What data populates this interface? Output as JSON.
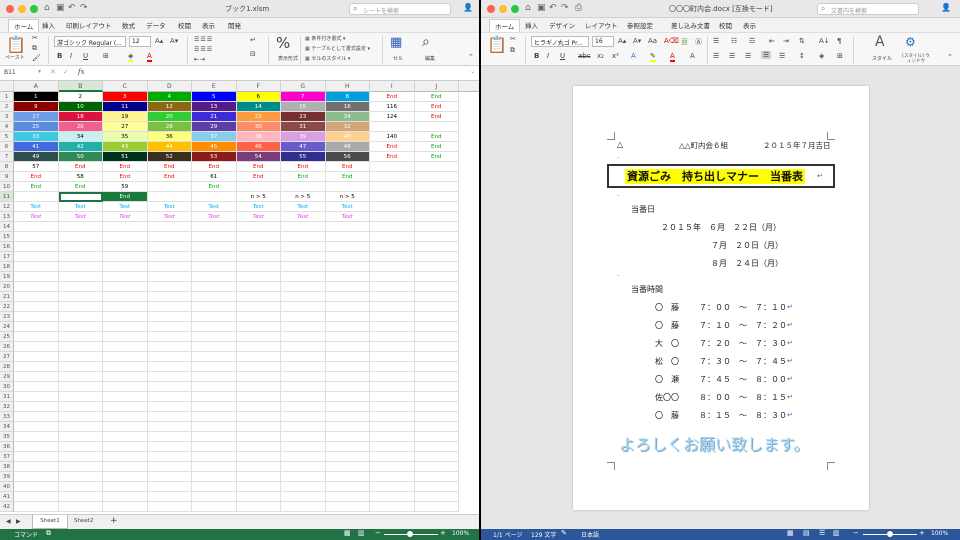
{
  "excel": {
    "title": "ブック1.xlsm",
    "search_placeholder": "シートを検索",
    "tabs": [
      "ホーム",
      "挿入",
      "印刷レイアウト",
      "数式",
      "データ",
      "校閲",
      "表示",
      "開発"
    ],
    "active_tab": "ホーム",
    "font_name": "游ゴシック Regular (...",
    "font_size": "12",
    "paste_label": "ペースト",
    "number_format_label": "表示形式",
    "cond_format_label": "条件付き書式",
    "table_format_label": "テーブルとして書式設定",
    "cell_style_label": "セルのスタイル",
    "cells_label": "セル",
    "edit_label": "編集",
    "name_box": "B11",
    "fx": "fx",
    "columns": [
      "A",
      "B",
      "C",
      "D",
      "E",
      "F",
      "G",
      "H",
      "I",
      "J"
    ],
    "rows": [
      [
        {
          "t": "1",
          "bg": "#000000",
          "fg": "#ffffff"
        },
        {
          "t": "2",
          "bg": "#ffffff",
          "fg": "#000000"
        },
        {
          "t": "3",
          "bg": "#ff0000",
          "fg": "#ffffff"
        },
        {
          "t": "4",
          "bg": "#00aa00",
          "fg": "#ffffff"
        },
        {
          "t": "5",
          "bg": "#0000ff",
          "fg": "#ffffff"
        },
        {
          "t": "6",
          "bg": "#ffff00",
          "fg": "#000000"
        },
        {
          "t": "7",
          "bg": "#ff00cc",
          "fg": "#ffffff"
        },
        {
          "t": "8",
          "bg": "#00a0e0",
          "fg": "#ffffff"
        },
        {
          "t": "End",
          "bg": "",
          "fg": "#ff0000"
        },
        {
          "t": "End",
          "bg": "",
          "fg": "#00aa00"
        }
      ],
      [
        {
          "t": "9",
          "bg": "#8b0000",
          "fg": "#ffffff"
        },
        {
          "t": "10",
          "bg": "#006400",
          "fg": "#ffffff"
        },
        {
          "t": "11",
          "bg": "#00008b",
          "fg": "#ffffff"
        },
        {
          "t": "12",
          "bg": "#8b6914",
          "fg": "#ffffff"
        },
        {
          "t": "13",
          "bg": "#551a8b",
          "fg": "#ffffff"
        },
        {
          "t": "14",
          "bg": "#008b8b",
          "fg": "#ffffff"
        },
        {
          "t": "15",
          "bg": "#b0b0b0",
          "fg": "#ffffff"
        },
        {
          "t": "16",
          "bg": "#707070",
          "fg": "#ffffff"
        },
        {
          "t": "116",
          "bg": "",
          "fg": "#000000"
        },
        {
          "t": "End",
          "bg": "",
          "fg": "#ff0000"
        }
      ],
      [
        {
          "t": "17",
          "bg": "#6a9ee8",
          "fg": "#ffffff"
        },
        {
          "t": "18",
          "bg": "#dc143c",
          "fg": "#ffffff"
        },
        {
          "t": "19",
          "bg": "#fff68f",
          "fg": "#000000"
        },
        {
          "t": "20",
          "bg": "#32cd32",
          "fg": "#ffffff"
        },
        {
          "t": "21",
          "bg": "#3d2bd8",
          "fg": "#ffffff"
        },
        {
          "t": "22",
          "bg": "#ff9a3c",
          "fg": "#ffffff"
        },
        {
          "t": "23",
          "bg": "#7a2f2f",
          "fg": "#ffffff"
        },
        {
          "t": "24",
          "bg": "#8fbc8f",
          "fg": "#ffffff"
        },
        {
          "t": "124",
          "bg": "",
          "fg": "#000000"
        },
        {
          "t": "End",
          "bg": "",
          "fg": "#ff0000"
        }
      ],
      [
        {
          "t": "25",
          "bg": "#5a8de0",
          "fg": "#ffffff"
        },
        {
          "t": "26",
          "bg": "#f06090",
          "fg": "#ffffff"
        },
        {
          "t": "27",
          "bg": "#ffff99",
          "fg": "#000000"
        },
        {
          "t": "28",
          "bg": "#7bc043",
          "fg": "#ffffff"
        },
        {
          "t": "29",
          "bg": "#5b3ea8",
          "fg": "#ffffff"
        },
        {
          "t": "30",
          "bg": "#ff8c69",
          "fg": "#ffffff"
        },
        {
          "t": "31",
          "bg": "#8b4a4a",
          "fg": "#ffffff"
        },
        {
          "t": "32",
          "bg": "#d2a679",
          "fg": "#ffffff"
        },
        {
          "t": "",
          "bg": "",
          "fg": "#000000"
        },
        {
          "t": "",
          "bg": "",
          "fg": "#000000"
        }
      ],
      [
        {
          "t": "33",
          "bg": "#40c8e0",
          "fg": "#ffffff"
        },
        {
          "t": "34",
          "bg": "#c8f0f0",
          "fg": "#000000"
        },
        {
          "t": "35",
          "bg": "#e8ffb0",
          "fg": "#000000"
        },
        {
          "t": "36",
          "bg": "#ffff80",
          "fg": "#000000"
        },
        {
          "t": "37",
          "bg": "#87ceeb",
          "fg": "#ffffff"
        },
        {
          "t": "38",
          "bg": "#ffb6c1",
          "fg": "#ffffff"
        },
        {
          "t": "39",
          "bg": "#d8a0e0",
          "fg": "#ffffff"
        },
        {
          "t": "40",
          "bg": "#ffd090",
          "fg": "#ffffff"
        },
        {
          "t": "140",
          "bg": "",
          "fg": "#000000"
        },
        {
          "t": "End",
          "bg": "",
          "fg": "#00aa00"
        }
      ],
      [
        {
          "t": "41",
          "bg": "#4169e1",
          "fg": "#ffffff"
        },
        {
          "t": "42",
          "bg": "#20b2aa",
          "fg": "#ffffff"
        },
        {
          "t": "43",
          "bg": "#9acd32",
          "fg": "#ffffff"
        },
        {
          "t": "44",
          "bg": "#ffc000",
          "fg": "#ffffff"
        },
        {
          "t": "45",
          "bg": "#ff8c00",
          "fg": "#ffffff"
        },
        {
          "t": "46",
          "bg": "#ff6347",
          "fg": "#ffffff"
        },
        {
          "t": "47",
          "bg": "#6a5acd",
          "fg": "#ffffff"
        },
        {
          "t": "48",
          "bg": "#a9a9a9",
          "fg": "#ffffff"
        },
        {
          "t": "End",
          "bg": "",
          "fg": "#ff0000"
        },
        {
          "t": "End",
          "bg": "",
          "fg": "#00aa00"
        }
      ],
      [
        {
          "t": "49",
          "bg": "#2f4f4f",
          "fg": "#ffffff"
        },
        {
          "t": "50",
          "bg": "#2e8b57",
          "fg": "#ffffff"
        },
        {
          "t": "51",
          "bg": "#013220",
          "fg": "#ffffff"
        },
        {
          "t": "52",
          "bg": "#3b2f1e",
          "fg": "#ffffff"
        },
        {
          "t": "53",
          "bg": "#8b1a1a",
          "fg": "#ffffff"
        },
        {
          "t": "54",
          "bg": "#7a3b7a",
          "fg": "#ffffff"
        },
        {
          "t": "55",
          "bg": "#2f2f8f",
          "fg": "#ffffff"
        },
        {
          "t": "56",
          "bg": "#4a4a4a",
          "fg": "#ffffff"
        },
        {
          "t": "End",
          "bg": "",
          "fg": "#ff0000"
        },
        {
          "t": "End",
          "bg": "",
          "fg": "#00aa00"
        }
      ],
      [
        {
          "t": "57",
          "bg": "",
          "fg": "#000000"
        },
        {
          "t": "End",
          "bg": "",
          "fg": "#ff0000"
        },
        {
          "t": "End",
          "bg": "",
          "fg": "#ff0000"
        },
        {
          "t": "End",
          "bg": "",
          "fg": "#ff0000"
        },
        {
          "t": "End",
          "bg": "",
          "fg": "#ff0000"
        },
        {
          "t": "End",
          "bg": "",
          "fg": "#ff0000"
        },
        {
          "t": "End",
          "bg": "",
          "fg": "#ff0000"
        },
        {
          "t": "End",
          "bg": "",
          "fg": "#ff0000"
        },
        {
          "t": "",
          "bg": "",
          "fg": "#000"
        },
        {
          "t": "",
          "bg": "",
          "fg": "#000"
        }
      ],
      [
        {
          "t": "End",
          "bg": "",
          "fg": "#ff0000"
        },
        {
          "t": "58",
          "bg": "",
          "fg": "#000000"
        },
        {
          "t": "End",
          "bg": "",
          "fg": "#ff0000"
        },
        {
          "t": "End",
          "bg": "",
          "fg": "#ff0000"
        },
        {
          "t": "61",
          "bg": "",
          "fg": "#000000"
        },
        {
          "t": "End",
          "bg": "",
          "fg": "#ff0000"
        },
        {
          "t": "End",
          "bg": "",
          "fg": "#00aa00"
        },
        {
          "t": "End",
          "bg": "",
          "fg": "#00aa00"
        },
        {
          "t": "",
          "bg": "",
          "fg": "#000"
        },
        {
          "t": "",
          "bg": "",
          "fg": "#000"
        }
      ],
      [
        {
          "t": "End",
          "bg": "",
          "fg": "#00aa00"
        },
        {
          "t": "End",
          "bg": "",
          "fg": "#00aa00"
        },
        {
          "t": "59",
          "bg": "",
          "fg": "#000000"
        },
        {
          "t": "",
          "bg": "",
          "fg": "#000"
        },
        {
          "t": "End",
          "bg": "",
          "fg": "#00aa00"
        },
        {
          "t": "",
          "bg": "",
          "fg": "#000"
        },
        {
          "t": "",
          "bg": "",
          "fg": "#000"
        },
        {
          "t": "",
          "bg": "",
          "fg": "#000"
        },
        {
          "t": "",
          "bg": "",
          "fg": "#000"
        },
        {
          "t": "",
          "bg": "",
          "fg": "#000"
        }
      ],
      [
        {
          "t": "",
          "bg": "",
          "fg": "#000"
        },
        {
          "t": "",
          "bg": "",
          "fg": "#000",
          "sel": true
        },
        {
          "t": "End",
          "bg": "#1a7a3c",
          "fg": "#ffffff"
        },
        {
          "t": "",
          "bg": "",
          "fg": "#000"
        },
        {
          "t": "",
          "bg": "",
          "fg": "#000"
        },
        {
          "t": "n > 5",
          "bg": "",
          "fg": "#000000"
        },
        {
          "t": "n > 5",
          "bg": "",
          "fg": "#000000"
        },
        {
          "t": "n > 5",
          "bg": "",
          "fg": "#000000"
        },
        {
          "t": "",
          "bg": "",
          "fg": "#000"
        },
        {
          "t": "",
          "bg": "",
          "fg": "#000"
        }
      ],
      [
        {
          "t": "Test",
          "bg": "",
          "fg": "#00b0f0"
        },
        {
          "t": "Test",
          "bg": "",
          "fg": "#00b0f0"
        },
        {
          "t": "Test",
          "bg": "",
          "fg": "#00b0f0"
        },
        {
          "t": "Test",
          "bg": "",
          "fg": "#00b0f0"
        },
        {
          "t": "Test",
          "bg": "",
          "fg": "#00b0f0"
        },
        {
          "t": "Test",
          "bg": "",
          "fg": "#00b0f0"
        },
        {
          "t": "Test",
          "bg": "",
          "fg": "#00b0f0"
        },
        {
          "t": "Test",
          "bg": "",
          "fg": "#00b0f0"
        },
        {
          "t": "",
          "bg": "",
          "fg": "#000"
        },
        {
          "t": "",
          "bg": "",
          "fg": "#000"
        }
      ],
      [
        {
          "t": "Test",
          "bg": "",
          "fg": "#e040e0",
          "i": true
        },
        {
          "t": "Test",
          "bg": "",
          "fg": "#e040e0",
          "i": true
        },
        {
          "t": "Test",
          "bg": "",
          "fg": "#e040e0",
          "i": true
        },
        {
          "t": "Test",
          "bg": "",
          "fg": "#e040e0",
          "i": true
        },
        {
          "t": "Test",
          "bg": "",
          "fg": "#e040e0",
          "i": true
        },
        {
          "t": "Test",
          "bg": "",
          "fg": "#e040e0",
          "i": true
        },
        {
          "t": "Test",
          "bg": "",
          "fg": "#e040e0",
          "i": true
        },
        {
          "t": "Test",
          "bg": "",
          "fg": "#e040e0",
          "i": true
        },
        {
          "t": "",
          "bg": "",
          "fg": "#000"
        },
        {
          "t": "",
          "bg": "",
          "fg": "#000"
        }
      ]
    ],
    "sheets": [
      "Sheet1",
      "Sheet2"
    ],
    "status_left": "コマンド",
    "zoom": "100%",
    "status_color": "#217346"
  },
  "word": {
    "title": "〇〇〇町内会.docx [互換モード]",
    "search_placeholder": "文書内を検索",
    "tabs": [
      "ホーム",
      "挿入",
      "デザイン",
      "レイアウト",
      "参照設定",
      "差し込み文書",
      "校閲",
      "表示"
    ],
    "active_tab": "ホーム",
    "font_name": "ヒラギノ丸ゴ Pr...",
    "font_size": "16",
    "style_label": "スタイル",
    "style_window_label": "[スタイル] ウィンドウ",
    "doc": {
      "header_left": "△",
      "header_mid": "△△町内会６組",
      "header_right": "２０１５年７月吉日",
      "title": "資源ごみ　持ち出しマナー　当番表",
      "duty_day_label": "当番日",
      "dates": [
        "２０１５年　６月　２２日（月）",
        "７月　２０日（月）",
        "８月　２４日（月）"
      ],
      "duty_time_label": "当番時間",
      "times": [
        {
          "name": "〇　藤",
          "time": "７：００　～　７：１０"
        },
        {
          "name": "〇　藤",
          "time": "７：１０　～　７：２０"
        },
        {
          "name": "大　〇",
          "time": "７：２０　～　７：３０"
        },
        {
          "name": "松　〇",
          "time": "７：３０　～　７：４５"
        },
        {
          "name": "〇　瀬",
          "time": "７：４５　～　８：００"
        },
        {
          "name": "佐〇〇",
          "time": "８：００　～　８：１５"
        },
        {
          "name": "〇　藤",
          "time": "８：１５　～　８：３０"
        }
      ],
      "closing": "よろしくお願い致します。"
    },
    "status_page": "1/1 ページ",
    "status_words": "129 文字",
    "status_lang": "日本語",
    "zoom": "100%",
    "status_color": "#2b579a"
  }
}
